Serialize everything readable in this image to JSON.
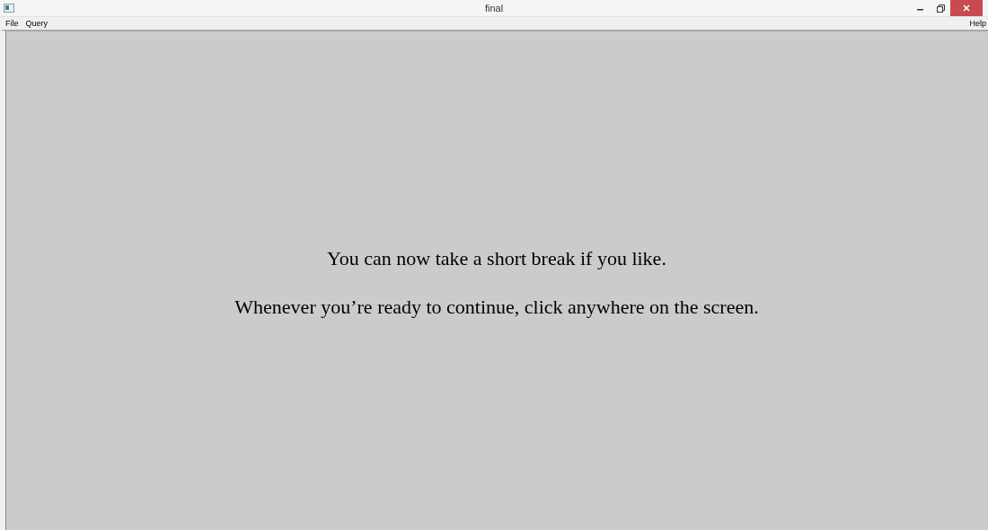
{
  "window": {
    "title": "final"
  },
  "menu": {
    "left": [
      "File",
      "Query"
    ],
    "right": [
      "Help"
    ]
  },
  "message": [
    "You can now take a short break if you like.",
    "Whenever you’re ready to continue, click anywhere on the screen."
  ]
}
